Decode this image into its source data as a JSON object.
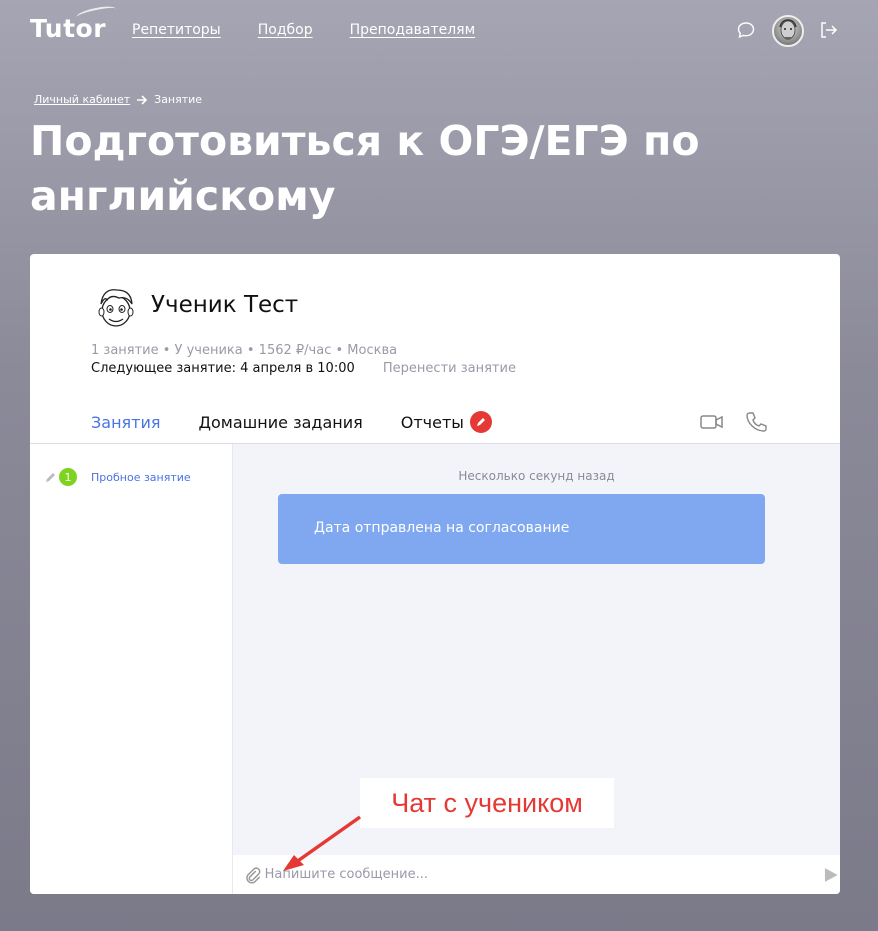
{
  "header": {
    "logo": "Tutor",
    "nav": [
      "Репетиторы",
      "Подбор",
      "Преподавателям"
    ],
    "icons": [
      "chat-bubble-icon",
      "user-avatar",
      "logout-icon"
    ]
  },
  "breadcrumb": {
    "parent": "Личный кабинет",
    "current": "Занятие"
  },
  "page": {
    "title": "Подготовиться к ОГЭ/ЕГЭ по английскому"
  },
  "student": {
    "name": "Ученик Тест",
    "meta": "1 занятие • У ученика • 1562 ₽/час • Москва",
    "next_lesson": "Следующее занятие: 4 апреля в 10:00",
    "reschedule": "Перенести занятие"
  },
  "tabs": [
    "Занятия",
    "Домашние задания",
    "Отчеты"
  ],
  "lessons": [
    {
      "number": "1",
      "label": "Пробное занятие"
    }
  ],
  "chat": {
    "timestamp": "Несколько секунд назад",
    "message": "Дата отправлена на согласование",
    "input_placeholder": "Напишите сообщение..."
  },
  "annotation": {
    "text": "Чат с учеником"
  },
  "colors": {
    "accent": "#4a73e3",
    "bubble": "#80a8f0",
    "badge_green": "#7ed321",
    "annotation_red": "#e53935"
  }
}
